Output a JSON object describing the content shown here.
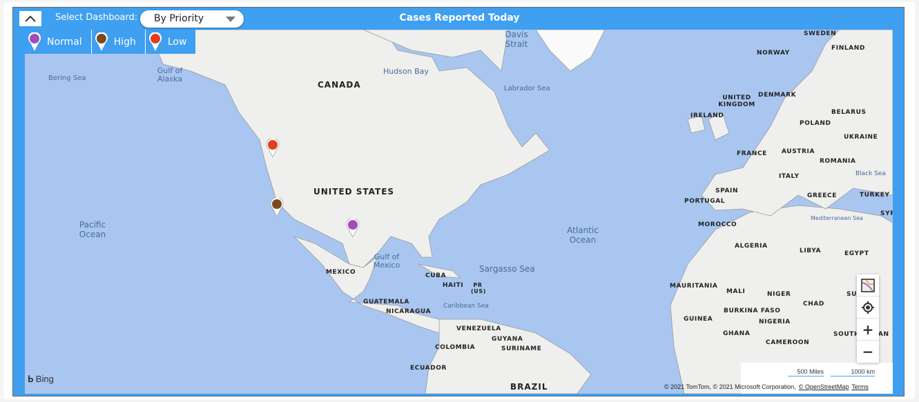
{
  "header": {
    "title": "Cases Reported Today",
    "select_label": "Select Dashboard:",
    "select_value": "By Priority"
  },
  "legend": [
    {
      "label": "Normal",
      "color": "#a24bbd"
    },
    {
      "label": "High",
      "color": "#7a4a22"
    },
    {
      "label": "Low",
      "color": "#e04020"
    }
  ],
  "map": {
    "countries": [
      "CANADA",
      "UNITED STATES",
      "MEXICO",
      "CUBA",
      "HAITI",
      "PR (US)",
      "GUATEMALA",
      "NICARAGUA",
      "VENEZUELA",
      "GUYANA",
      "SURINAME",
      "COLOMBIA",
      "ECUADOR",
      "BRAZIL",
      "SWEDEN",
      "FINLAND",
      "NORWAY",
      "UNITED KINGDOM",
      "DENMARK",
      "IRELAND",
      "BELARUS",
      "POLAND",
      "UKRAINE",
      "FRANCE",
      "AUSTRIA",
      "ROMANIA",
      "SPAIN",
      "PORTUGAL",
      "ITALY",
      "GREECE",
      "TURKEY",
      "MOROCCO",
      "ALGERIA",
      "LIBYA",
      "EGYPT",
      "MAURITANIA",
      "MALI",
      "NIGER",
      "CHAD",
      "SUDAN",
      "BURKINA FASO",
      "GUINEA",
      "NIGERIA",
      "GHANA",
      "CAMEROON",
      "SOUTH SUDAN",
      "SYRIA"
    ],
    "water": [
      "Davis Strait",
      "Bering Sea",
      "Gulf of Alaska",
      "Hudson Bay",
      "Labrador Sea",
      "Pacific Ocean",
      "Atlantic Ocean",
      "Gulf of Mexico",
      "Sargasso Sea",
      "Caribbean Sea",
      "Mediterranean Sea",
      "Black Sea"
    ],
    "pins": [
      {
        "priority": "Low",
        "color": "#e04020"
      },
      {
        "priority": "High",
        "color": "#7a4a22"
      },
      {
        "priority": "Normal",
        "color": "#a24bbd"
      }
    ]
  },
  "controls": {
    "scale_miles": "500 Miles",
    "scale_km": "1000 km",
    "copyright": "© 2021 TomTom, © 2021 Microsoft Corporation,",
    "osm": "© OpenStreetMap",
    "terms": "Terms",
    "bing": "Bing"
  }
}
